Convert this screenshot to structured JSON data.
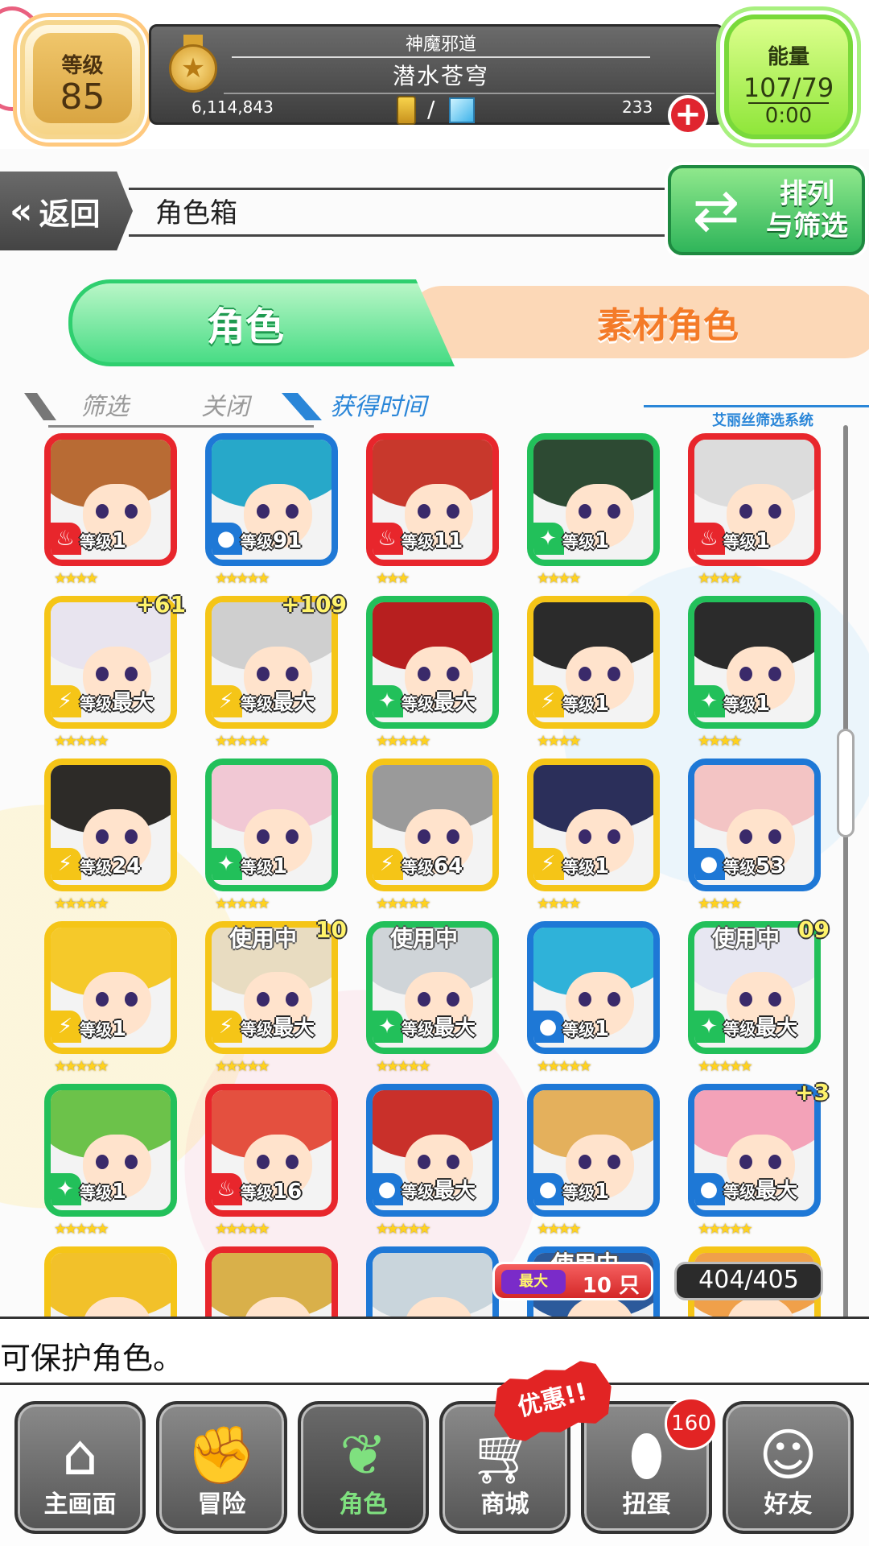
{
  "top_bar": {
    "level_label": "等级",
    "level_value": "85",
    "title_sub": "神魔邪道",
    "title_main": "潜水苍穹",
    "coins": "6,114,843",
    "gems": "233",
    "energy_label": "能量",
    "energy_value": "107/79",
    "energy_timer": "0:00"
  },
  "header": {
    "back_label": "返回",
    "back_icon": "«",
    "page_title": "角色箱",
    "sort_label_line1": "排列",
    "sort_label_line2": "与筛选"
  },
  "tabs": {
    "character": "角色",
    "material": "素材角色"
  },
  "filters": {
    "filter": "筛选",
    "off": "关闭",
    "sort_by": "获得时间",
    "system": "艾丽丝筛选系统"
  },
  "colors": {
    "fire": "#e8262c",
    "water": "#1e78d6",
    "wood": "#22c05a",
    "light": "#f5c517",
    "accent_green": "#2fcf6f",
    "accent_orange": "#f47b28"
  },
  "cards": [
    {
      "element": "fire",
      "level": "1",
      "stars": "★★★★",
      "hair": "#b86b34"
    },
    {
      "element": "water",
      "level": "91",
      "stars": "★★★★★",
      "hair": "#27a8c9"
    },
    {
      "element": "fire",
      "level": "11",
      "stars": "★★★",
      "hair": "#c8382c"
    },
    {
      "element": "wood",
      "level": "1",
      "stars": "★★★★",
      "hair": "#2d4a33"
    },
    {
      "element": "fire",
      "level": "1",
      "stars": "★★★★",
      "hair": "#dcdcdc"
    },
    {
      "element": "light",
      "level": "最大",
      "stars": "★★★★★",
      "hair": "#e8e4ef",
      "plus": "+61"
    },
    {
      "element": "light",
      "level": "最大",
      "stars": "★★★★★",
      "hair": "#cfcfcf",
      "plus": "+109"
    },
    {
      "element": "wood",
      "level": "最大",
      "stars": "★★★★★",
      "hair": "#b71f1f"
    },
    {
      "element": "light",
      "level": "1",
      "stars": "★★★★",
      "hair": "#2b2b2b"
    },
    {
      "element": "wood",
      "level": "1",
      "stars": "★★★★",
      "hair": "#2b2b2b"
    },
    {
      "element": "light",
      "level": "24",
      "stars": "★★★★★",
      "hair": "#2d2b28"
    },
    {
      "element": "wood",
      "level": "1",
      "stars": "★★★★★",
      "hair": "#f1c8d4"
    },
    {
      "element": "light",
      "level": "64",
      "stars": "★★★★★",
      "hair": "#9a9a9a"
    },
    {
      "element": "light",
      "level": "1",
      "stars": "★★★★",
      "hair": "#2b2f5a"
    },
    {
      "element": "water",
      "level": "53",
      "stars": "★★★★",
      "hair": "#f3c4c4"
    },
    {
      "element": "light",
      "level": "1",
      "stars": "★★★★★",
      "hair": "#f5c92a"
    },
    {
      "element": "light",
      "level": "最大",
      "stars": "★★★★★",
      "hair": "#e8dcc1",
      "inuse": "使用中",
      "plus": "10"
    },
    {
      "element": "wood",
      "level": "最大",
      "stars": "★★★★★",
      "hair": "#cfd4d8",
      "inuse": "使用中"
    },
    {
      "element": "water",
      "level": "1",
      "stars": "★★★★★",
      "hair": "#2fb2d9"
    },
    {
      "element": "wood",
      "level": "最大",
      "stars": "★★★★★",
      "hair": "#e7e7f2",
      "inuse": "使用中",
      "plus": "09"
    },
    {
      "element": "wood",
      "level": "1",
      "stars": "★★★★★",
      "hair": "#6cc24a"
    },
    {
      "element": "fire",
      "level": "16",
      "stars": "★★★★★",
      "hair": "#e4503f"
    },
    {
      "element": "water",
      "level": "最大",
      "stars": "★★★★★",
      "hair": "#c9302a"
    },
    {
      "element": "water",
      "level": "1",
      "stars": "★★★★",
      "hair": "#e4b05c"
    },
    {
      "element": "water",
      "level": "最大",
      "stars": "★★★★★",
      "hair": "#f3a2b8",
      "plus": "+3"
    },
    {
      "element": "light",
      "level": "",
      "stars": "",
      "hair": "#f2c12a"
    },
    {
      "element": "fire",
      "level": "",
      "stars": "",
      "hair": "#d9b04a"
    },
    {
      "element": "water",
      "level": "",
      "stars": "",
      "hair": "#c9d5dc"
    },
    {
      "element": "water",
      "level": "",
      "stars": "",
      "hair": "#2c5a9b",
      "inuse": "使用中"
    },
    {
      "element": "light",
      "level": "",
      "stars": "",
      "hair": "#f0a04a"
    }
  ],
  "level_prefix": "等级",
  "counters": {
    "max_tag": "最大",
    "max_count": "10 只",
    "box_count": "404/405"
  },
  "message": "可保护角色。",
  "bottom_nav": [
    {
      "label": "主画面",
      "icon": "home-icon"
    },
    {
      "label": "冒险",
      "icon": "handshake-icon"
    },
    {
      "label": "角色",
      "icon": "bunny-icon"
    },
    {
      "label": "商城",
      "icon": "cart-icon"
    },
    {
      "label": "扭蛋",
      "icon": "egg-icon"
    },
    {
      "label": "好友",
      "icon": "friends-icon"
    }
  ],
  "sale_tag": "优惠!!",
  "gacha_badge": "160"
}
